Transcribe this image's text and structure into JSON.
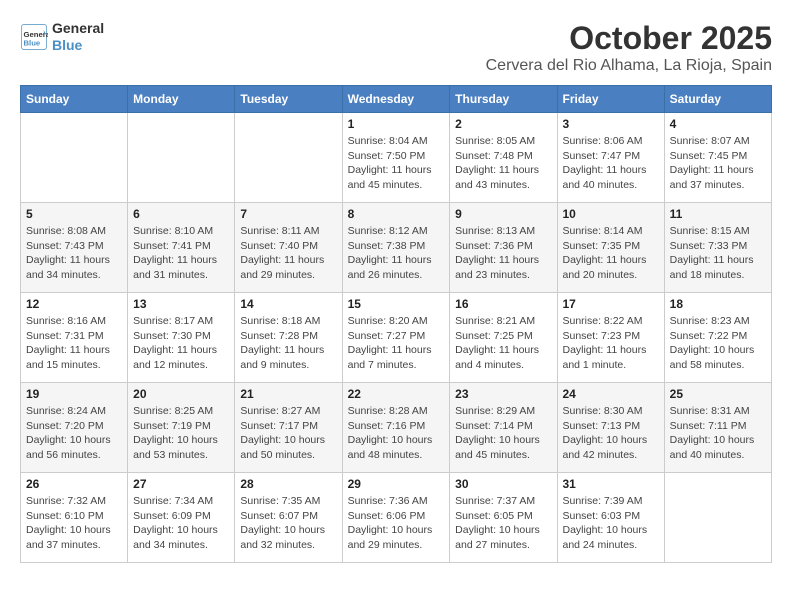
{
  "logo": {
    "line1": "General",
    "line2": "Blue"
  },
  "title": "October 2025",
  "location": "Cervera del Rio Alhama, La Rioja, Spain",
  "headers": [
    "Sunday",
    "Monday",
    "Tuesday",
    "Wednesday",
    "Thursday",
    "Friday",
    "Saturday"
  ],
  "weeks": [
    [
      {
        "day": "",
        "info": ""
      },
      {
        "day": "",
        "info": ""
      },
      {
        "day": "",
        "info": ""
      },
      {
        "day": "1",
        "info": "Sunrise: 8:04 AM\nSunset: 7:50 PM\nDaylight: 11 hours and 45 minutes."
      },
      {
        "day": "2",
        "info": "Sunrise: 8:05 AM\nSunset: 7:48 PM\nDaylight: 11 hours and 43 minutes."
      },
      {
        "day": "3",
        "info": "Sunrise: 8:06 AM\nSunset: 7:47 PM\nDaylight: 11 hours and 40 minutes."
      },
      {
        "day": "4",
        "info": "Sunrise: 8:07 AM\nSunset: 7:45 PM\nDaylight: 11 hours and 37 minutes."
      }
    ],
    [
      {
        "day": "5",
        "info": "Sunrise: 8:08 AM\nSunset: 7:43 PM\nDaylight: 11 hours and 34 minutes."
      },
      {
        "day": "6",
        "info": "Sunrise: 8:10 AM\nSunset: 7:41 PM\nDaylight: 11 hours and 31 minutes."
      },
      {
        "day": "7",
        "info": "Sunrise: 8:11 AM\nSunset: 7:40 PM\nDaylight: 11 hours and 29 minutes."
      },
      {
        "day": "8",
        "info": "Sunrise: 8:12 AM\nSunset: 7:38 PM\nDaylight: 11 hours and 26 minutes."
      },
      {
        "day": "9",
        "info": "Sunrise: 8:13 AM\nSunset: 7:36 PM\nDaylight: 11 hours and 23 minutes."
      },
      {
        "day": "10",
        "info": "Sunrise: 8:14 AM\nSunset: 7:35 PM\nDaylight: 11 hours and 20 minutes."
      },
      {
        "day": "11",
        "info": "Sunrise: 8:15 AM\nSunset: 7:33 PM\nDaylight: 11 hours and 18 minutes."
      }
    ],
    [
      {
        "day": "12",
        "info": "Sunrise: 8:16 AM\nSunset: 7:31 PM\nDaylight: 11 hours and 15 minutes."
      },
      {
        "day": "13",
        "info": "Sunrise: 8:17 AM\nSunset: 7:30 PM\nDaylight: 11 hours and 12 minutes."
      },
      {
        "day": "14",
        "info": "Sunrise: 8:18 AM\nSunset: 7:28 PM\nDaylight: 11 hours and 9 minutes."
      },
      {
        "day": "15",
        "info": "Sunrise: 8:20 AM\nSunset: 7:27 PM\nDaylight: 11 hours and 7 minutes."
      },
      {
        "day": "16",
        "info": "Sunrise: 8:21 AM\nSunset: 7:25 PM\nDaylight: 11 hours and 4 minutes."
      },
      {
        "day": "17",
        "info": "Sunrise: 8:22 AM\nSunset: 7:23 PM\nDaylight: 11 hours and 1 minute."
      },
      {
        "day": "18",
        "info": "Sunrise: 8:23 AM\nSunset: 7:22 PM\nDaylight: 10 hours and 58 minutes."
      }
    ],
    [
      {
        "day": "19",
        "info": "Sunrise: 8:24 AM\nSunset: 7:20 PM\nDaylight: 10 hours and 56 minutes."
      },
      {
        "day": "20",
        "info": "Sunrise: 8:25 AM\nSunset: 7:19 PM\nDaylight: 10 hours and 53 minutes."
      },
      {
        "day": "21",
        "info": "Sunrise: 8:27 AM\nSunset: 7:17 PM\nDaylight: 10 hours and 50 minutes."
      },
      {
        "day": "22",
        "info": "Sunrise: 8:28 AM\nSunset: 7:16 PM\nDaylight: 10 hours and 48 minutes."
      },
      {
        "day": "23",
        "info": "Sunrise: 8:29 AM\nSunset: 7:14 PM\nDaylight: 10 hours and 45 minutes."
      },
      {
        "day": "24",
        "info": "Sunrise: 8:30 AM\nSunset: 7:13 PM\nDaylight: 10 hours and 42 minutes."
      },
      {
        "day": "25",
        "info": "Sunrise: 8:31 AM\nSunset: 7:11 PM\nDaylight: 10 hours and 40 minutes."
      }
    ],
    [
      {
        "day": "26",
        "info": "Sunrise: 7:32 AM\nSunset: 6:10 PM\nDaylight: 10 hours and 37 minutes."
      },
      {
        "day": "27",
        "info": "Sunrise: 7:34 AM\nSunset: 6:09 PM\nDaylight: 10 hours and 34 minutes."
      },
      {
        "day": "28",
        "info": "Sunrise: 7:35 AM\nSunset: 6:07 PM\nDaylight: 10 hours and 32 minutes."
      },
      {
        "day": "29",
        "info": "Sunrise: 7:36 AM\nSunset: 6:06 PM\nDaylight: 10 hours and 29 minutes."
      },
      {
        "day": "30",
        "info": "Sunrise: 7:37 AM\nSunset: 6:05 PM\nDaylight: 10 hours and 27 minutes."
      },
      {
        "day": "31",
        "info": "Sunrise: 7:39 AM\nSunset: 6:03 PM\nDaylight: 10 hours and 24 minutes."
      },
      {
        "day": "",
        "info": ""
      }
    ]
  ]
}
